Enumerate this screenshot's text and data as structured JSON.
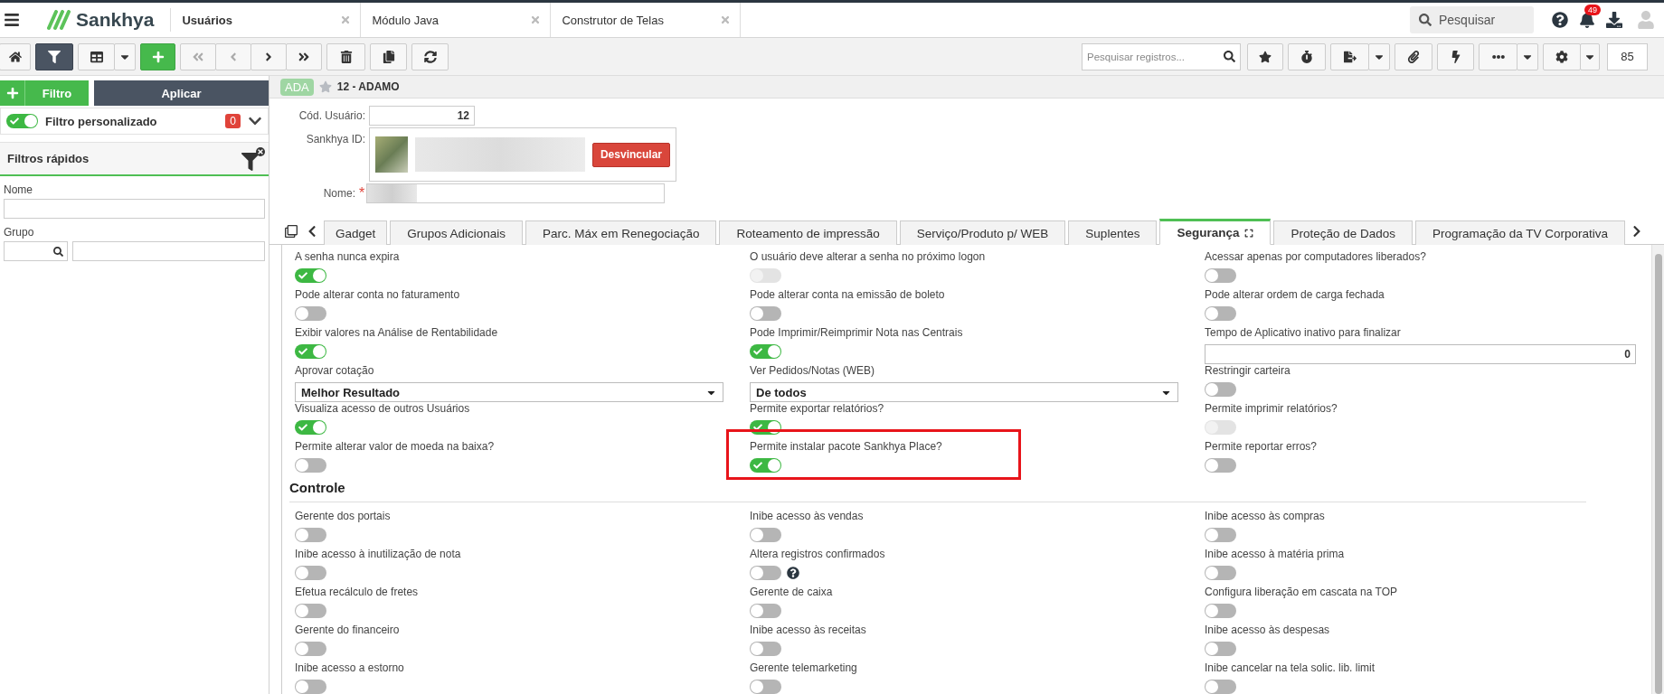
{
  "topbar": {
    "brand": "Sankhya",
    "tabs": [
      {
        "label": "Usuários",
        "selected": true
      },
      {
        "label": "Módulo Java",
        "selected": false
      },
      {
        "label": "Construtor de Telas",
        "selected": false
      }
    ],
    "search": {
      "placeholder": "Pesquisar"
    },
    "notifications": "49"
  },
  "toolbar": {
    "filter_active": true,
    "search": {
      "placeholder": "Pesquisar registros..."
    },
    "page_size": "85"
  },
  "filter_panel": {
    "filter_button": "Filtro",
    "apply_button": "Aplicar",
    "custom_filter": {
      "label": "Filtro personalizado",
      "on": true,
      "count": "0"
    },
    "quick_filters": {
      "title": "Filtros rápidos",
      "fields": [
        {
          "label": "Nome",
          "kind": "text"
        },
        {
          "label": "Grupo",
          "kind": "lookup"
        }
      ]
    }
  },
  "record": {
    "badge": "ADA",
    "title": "12 - ADAMO"
  },
  "form": {
    "code": {
      "label": "Cód. Usuário:",
      "value": "12"
    },
    "sankhya_id": {
      "label": "Sankhya ID:",
      "button": "Desvincular"
    },
    "name": {
      "label": "Nome:",
      "required_mark": "*"
    }
  },
  "tabs": [
    {
      "label": "Gadget",
      "selected": false
    },
    {
      "label": "Grupos Adicionais",
      "selected": false
    },
    {
      "label": "Parc. Máx em Renegociação",
      "selected": false
    },
    {
      "label": "Roteamento de impressão",
      "selected": false
    },
    {
      "label": "Serviço/Produto p/ WEB",
      "selected": false
    },
    {
      "label": "Suplentes",
      "selected": false
    },
    {
      "label": "Segurança",
      "selected": true
    },
    {
      "label": "Proteção de Dados",
      "selected": false
    },
    {
      "label": "Programação da TV Corporativa",
      "selected": false
    }
  ],
  "sections": [
    {
      "items": [
        {
          "kind": "toggle",
          "label": "A senha nunca expira",
          "on": true,
          "disabled": false,
          "highlighted": false,
          "help": false
        },
        {
          "kind": "toggle",
          "label": "O usuário deve alterar a senha no próximo logon",
          "on": false,
          "disabled": true,
          "highlighted": false,
          "help": false
        },
        {
          "kind": "toggle",
          "label": "Acessar apenas por computadores liberados?",
          "on": false,
          "disabled": false,
          "highlighted": false,
          "help": false
        },
        {
          "kind": "toggle",
          "label": "Pode alterar conta no faturamento",
          "on": false,
          "disabled": false,
          "highlighted": false,
          "help": false
        },
        {
          "kind": "toggle",
          "label": "Pode alterar conta na emissão de boleto",
          "on": false,
          "disabled": false,
          "highlighted": false,
          "help": false
        },
        {
          "kind": "toggle",
          "label": "Pode alterar ordem de carga fechada",
          "on": false,
          "disabled": false,
          "highlighted": false,
          "help": false
        },
        {
          "kind": "toggle",
          "label": "Exibir valores na Análise de Rentabilidade",
          "on": true,
          "disabled": false,
          "highlighted": false,
          "help": false
        },
        {
          "kind": "toggle",
          "label": "Pode Imprimir/Reimprimir Nota nas Centrais",
          "on": true,
          "disabled": false,
          "highlighted": false,
          "help": false
        },
        {
          "kind": "number",
          "label": "Tempo de Aplicativo inativo para finalizar",
          "value": "0"
        },
        {
          "kind": "select",
          "label": "Aprovar cotação",
          "value": "Melhor Resultado"
        },
        {
          "kind": "select",
          "label": "Ver Pedidos/Notas (WEB)",
          "value": "De todos"
        },
        {
          "kind": "toggle",
          "label": "Restringir carteira",
          "on": false,
          "disabled": false,
          "highlighted": false,
          "help": false
        },
        {
          "kind": "toggle",
          "label": "Visualiza acesso de outros Usuários",
          "on": true,
          "disabled": false,
          "highlighted": false,
          "help": false
        },
        {
          "kind": "toggle",
          "label": "Permite exportar relatórios?",
          "on": true,
          "disabled": false,
          "highlighted": false,
          "help": false
        },
        {
          "kind": "toggle",
          "label": "Permite imprimir relatórios?",
          "on": false,
          "disabled": true,
          "highlighted": false,
          "help": false
        },
        {
          "kind": "toggle",
          "label": "Permite alterar valor de moeda na baixa?",
          "on": false,
          "disabled": false,
          "highlighted": false,
          "help": false
        },
        {
          "kind": "toggle",
          "label": "Permite instalar pacote Sankhya Place?",
          "on": true,
          "disabled": false,
          "highlighted": true,
          "help": false
        },
        {
          "kind": "toggle",
          "label": "Permite reportar erros?",
          "on": false,
          "disabled": false,
          "highlighted": false,
          "help": false
        }
      ]
    },
    {
      "title": "Controle",
      "items": [
        {
          "kind": "toggle",
          "label": "Gerente dos portais",
          "on": false,
          "disabled": false,
          "highlighted": false,
          "help": false
        },
        {
          "kind": "toggle",
          "label": "Inibe acesso às vendas",
          "on": false,
          "disabled": false,
          "highlighted": false,
          "help": false
        },
        {
          "kind": "toggle",
          "label": "Inibe acesso às compras",
          "on": false,
          "disabled": false,
          "highlighted": false,
          "help": false
        },
        {
          "kind": "toggle",
          "label": "Inibe acesso à inutilização de nota",
          "on": false,
          "disabled": false,
          "highlighted": false,
          "help": false
        },
        {
          "kind": "toggle",
          "label": "Altera registros confirmados",
          "on": false,
          "disabled": false,
          "highlighted": false,
          "help": true
        },
        {
          "kind": "toggle",
          "label": "Inibe acesso à matéria prima",
          "on": false,
          "disabled": false,
          "highlighted": false,
          "help": false
        },
        {
          "kind": "toggle",
          "label": "Efetua recálculo de fretes",
          "on": false,
          "disabled": false,
          "highlighted": false,
          "help": false
        },
        {
          "kind": "toggle",
          "label": "Gerente de caixa",
          "on": false,
          "disabled": false,
          "highlighted": false,
          "help": false
        },
        {
          "kind": "toggle",
          "label": "Configura liberação em cascata na TOP",
          "on": false,
          "disabled": false,
          "highlighted": false,
          "help": false
        },
        {
          "kind": "toggle",
          "label": "Gerente do financeiro",
          "on": false,
          "disabled": false,
          "highlighted": false,
          "help": false
        },
        {
          "kind": "toggle",
          "label": "Inibe acesso às receitas",
          "on": false,
          "disabled": false,
          "highlighted": false,
          "help": false
        },
        {
          "kind": "toggle",
          "label": "Inibe acesso às despesas",
          "on": false,
          "disabled": false,
          "highlighted": false,
          "help": false
        },
        {
          "kind": "toggle",
          "label": "Inibe acesso a estorno",
          "on": false,
          "disabled": false,
          "highlighted": false,
          "help": false
        },
        {
          "kind": "toggle",
          "label": "Gerente telemarketing",
          "on": false,
          "disabled": false,
          "highlighted": false,
          "help": false
        },
        {
          "kind": "toggle",
          "label": "Inibe cancelar na tela solic. lib. limit",
          "on": false,
          "disabled": false,
          "highlighted": false,
          "help": false
        }
      ]
    }
  ]
}
